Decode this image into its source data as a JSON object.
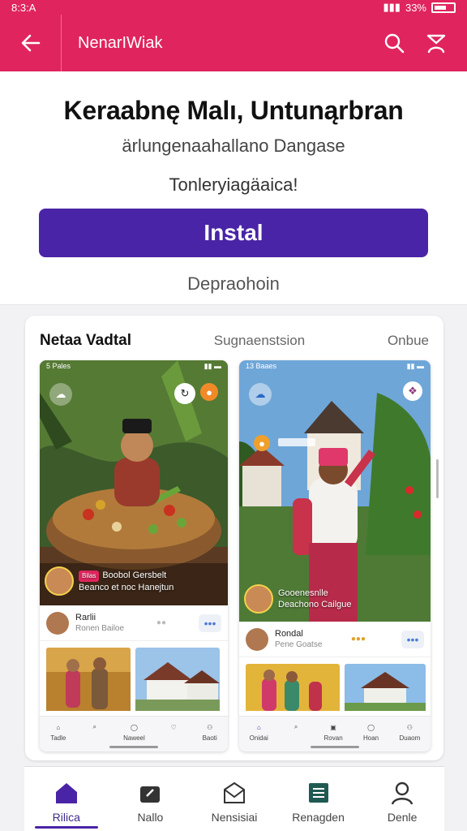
{
  "status_bar": {
    "time": "8:3:A",
    "battery": "33%"
  },
  "app_bar": {
    "title": "NenarIWiak"
  },
  "hero": {
    "title": "Keraabnę Malı, Untunąrbran",
    "subtitle": "ärlungenaahallano Dangase",
    "tagline": "Tonleryiagäaica!",
    "install_label": "Instal",
    "description": "Depraohoin"
  },
  "screenshots": {
    "title": "Netaa Vadtal",
    "middle_label": "Sugnaenstsion",
    "right_label": "Onbue",
    "left": {
      "status": "5 Pales",
      "caption_badge": "Bilas",
      "caption_line1": "Boobol Gersbelt",
      "caption_line2": "Beanco et noc Hanejtun",
      "user_name": "Rarlii",
      "user_sub": "Ronen Bailoe",
      "nav": [
        "Tadle",
        "",
        "Naweel",
        "",
        "Baoti"
      ]
    },
    "right": {
      "status": "13 Baaes",
      "caption_line1": "Gooenesnlle",
      "caption_line2": "Deachono Cailgue",
      "user_name": "Rondal",
      "user_sub": "Pene Goatse",
      "nav": [
        "Onidai",
        "",
        "Rovan",
        "Hoan",
        "Duaom"
      ]
    }
  },
  "bottom_nav": [
    {
      "label": "Rilica",
      "icon": "home-icon",
      "active": true
    },
    {
      "label": "Nallo",
      "icon": "bag-icon",
      "active": false
    },
    {
      "label": "Nensisiai",
      "icon": "mail-icon",
      "active": false
    },
    {
      "label": "Renagden",
      "icon": "list-icon",
      "active": false
    },
    {
      "label": "Denle",
      "icon": "person-icon",
      "active": false
    }
  ],
  "colors": {
    "brand": "#e0245e",
    "accent": "#4a24a6"
  }
}
